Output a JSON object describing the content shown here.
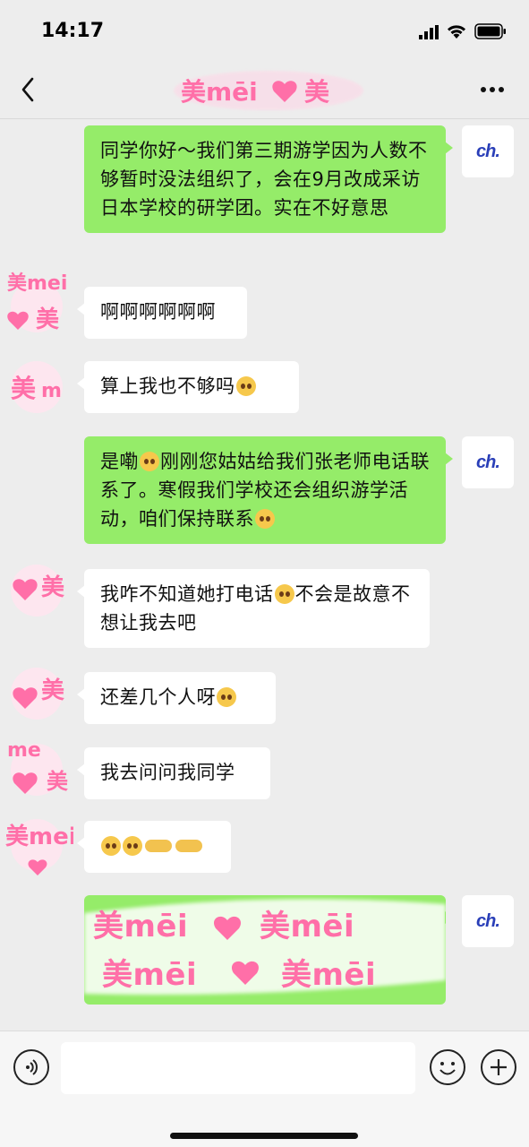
{
  "status_bar": {
    "time": "14:17"
  },
  "header": {
    "title_text": "美mēi",
    "back_icon": "chevron-left-icon",
    "more_icon": "more-horizontal-icon"
  },
  "self_avatar": {
    "logo_text": "ch."
  },
  "peer_avatar": {
    "sticker_text": "美mei"
  },
  "messages": [
    {
      "side": "right",
      "text": "同学你好～我们第三期游学因为人数不够暂时没法组织了，会在9月改成采访日本学校的研学团。实在不好意思"
    },
    {
      "side": "left",
      "text": "啊啊啊啊啊啊"
    },
    {
      "side": "left",
      "text": "算上我也不够吗"
    },
    {
      "side": "right",
      "text_a": "是嘞",
      "text_b": "刚刚您姑姑给我们张老师电话联系了。寒假我们学校还会组织游学活动，咱们保持联系"
    },
    {
      "side": "left",
      "text_a": "我咋不知道她打电话",
      "text_b": "不会是故意不想让我去吧"
    },
    {
      "side": "left",
      "text": "还差几个人呀"
    },
    {
      "side": "left",
      "text": "我去问问我同学"
    },
    {
      "side": "left",
      "emoji_only": true
    },
    {
      "side": "right",
      "censored_overlay": "美mēi"
    }
  ],
  "input_bar": {
    "value": "",
    "voice_icon": "voice-icon",
    "emoji_icon": "smiley-icon",
    "plus_icon": "plus-icon"
  },
  "colors": {
    "self_bubble": "#95ec69",
    "peer_bubble": "#ffffff",
    "sticker_pink": "#ff6fa8",
    "logo_blue": "#2a3fb8"
  }
}
